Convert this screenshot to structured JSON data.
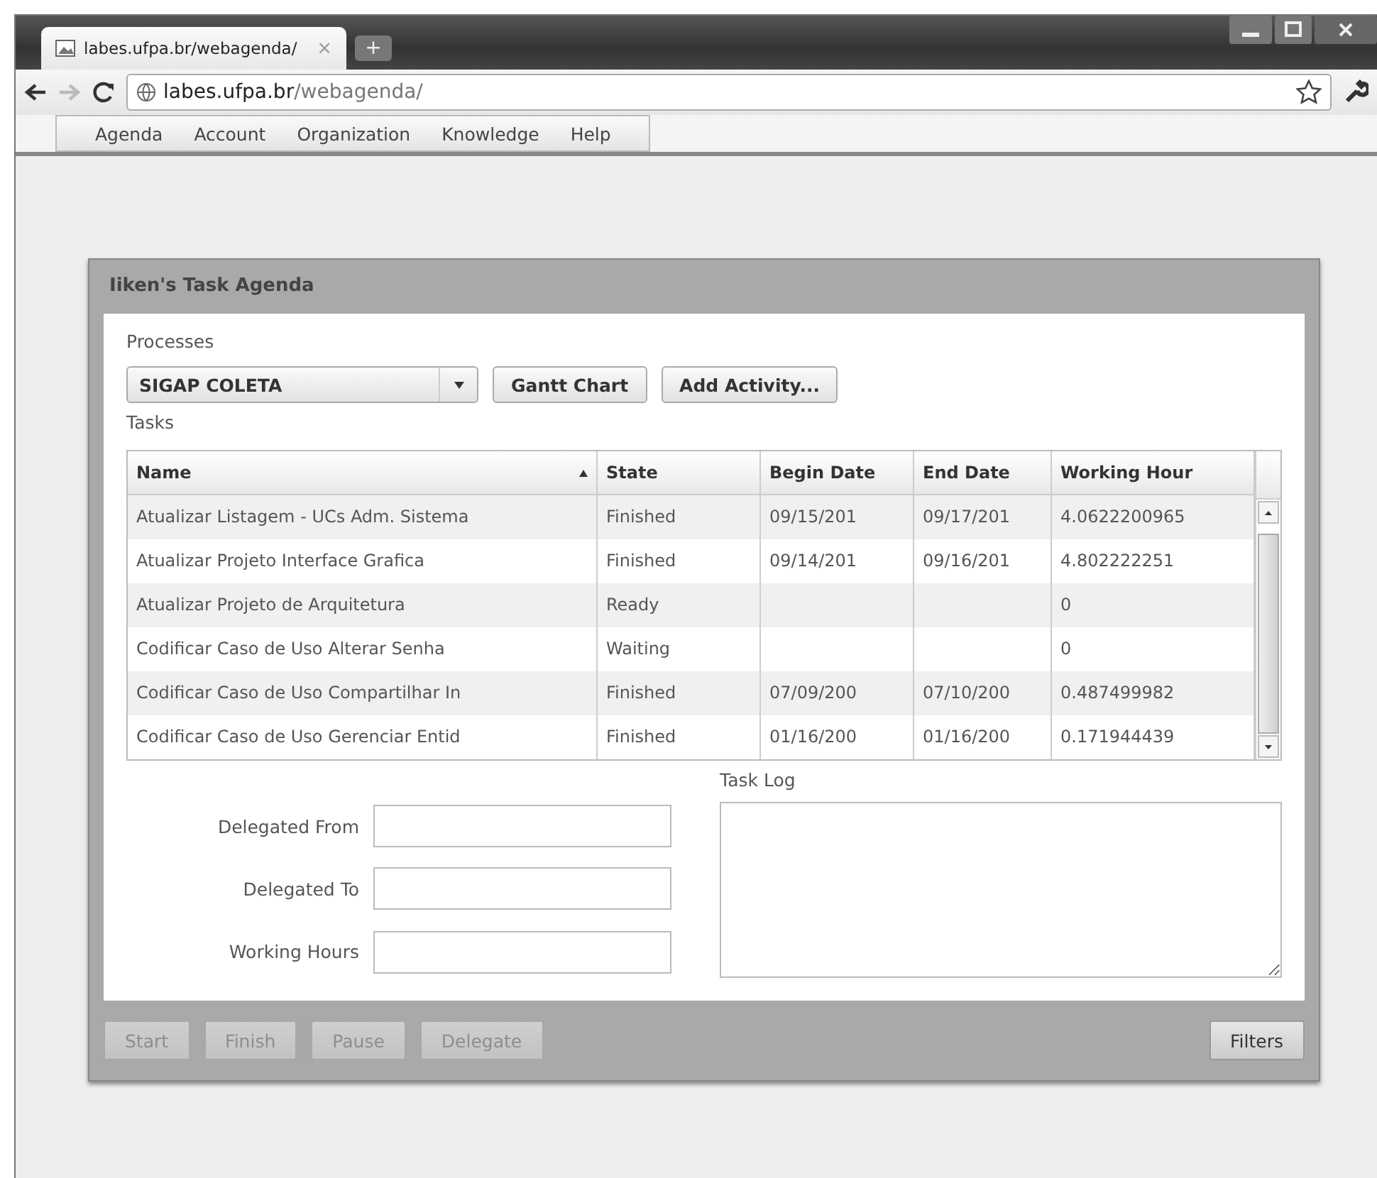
{
  "browser": {
    "tab": {
      "title": "labes.ufpa.br/webagenda/",
      "close": "×"
    },
    "new_tab": "+",
    "address": {
      "host": "labes.ufpa.br",
      "path": "/webagenda/"
    }
  },
  "menu": [
    "Agenda",
    "Account",
    "Organization",
    "Knowledge",
    "Help"
  ],
  "panel": {
    "title": "Iiken's Task Agenda",
    "processes_label": "Processes",
    "process": "SIGAP COLETA",
    "buttons": [
      "Gantt Chart",
      "Add Activity..."
    ],
    "tasks_label": "Tasks",
    "table": {
      "columns": [
        {
          "label": "Name",
          "sorted": true
        },
        {
          "label": "State",
          "sorted": false
        },
        {
          "label": "Begin Date",
          "sorted": false
        },
        {
          "label": "End Date",
          "sorted": false
        },
        {
          "label": "Working Hour",
          "sorted": false
        }
      ],
      "rows": [
        [
          "Atualizar Listagem - UCs Adm. Sistema",
          "Finished",
          "09/15/201",
          "09/17/201",
          "4.0622200965"
        ],
        [
          "Atualizar Projeto Interface Grafica",
          "Finished",
          "09/14/201",
          "09/16/201",
          "4.802222251"
        ],
        [
          "Atualizar Projeto de Arquitetura",
          "Ready",
          "",
          "",
          "0"
        ],
        [
          "Codificar Caso de Uso Alterar Senha",
          "Waiting",
          "",
          "",
          "0"
        ],
        [
          "Codificar Caso de Uso Compartilhar In",
          "Finished",
          "07/09/200",
          "07/10/200",
          "0.487499982"
        ],
        [
          "Codificar Caso de Uso Gerenciar Entid",
          "Finished",
          "01/16/200",
          "01/16/200",
          "0.171944439"
        ]
      ]
    },
    "fields": [
      {
        "label": "Delegated From"
      },
      {
        "label": "Delegated To"
      },
      {
        "label": "Working Hours"
      }
    ],
    "task_log_label": "Task Log",
    "actions": [
      {
        "label": "Start",
        "disabled": true
      },
      {
        "label": "Finish",
        "disabled": true
      },
      {
        "label": "Pause",
        "disabled": true
      },
      {
        "label": "Delegate",
        "disabled": true
      }
    ],
    "filters": "Filters"
  }
}
